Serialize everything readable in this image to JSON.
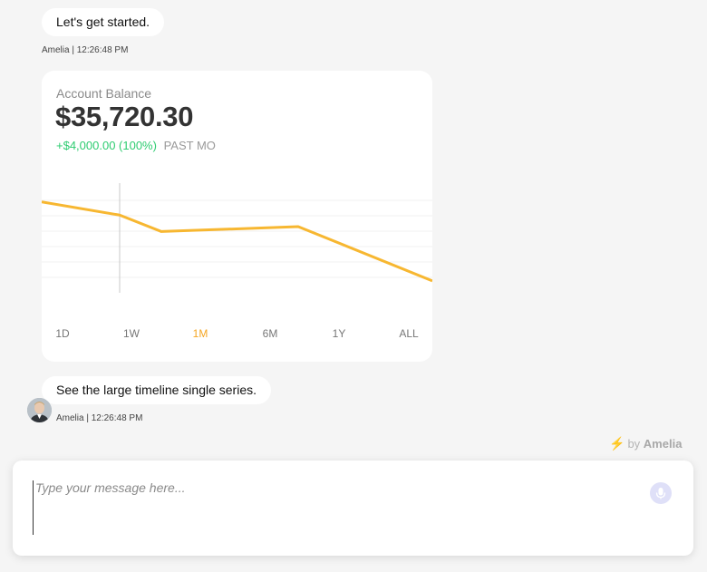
{
  "messages": [
    {
      "text": "Let's get started.",
      "meta": "Amelia | 12:26:48 PM"
    },
    {
      "text": "See the large timeline single series.",
      "meta": "Amelia | 12:26:48 PM"
    }
  ],
  "balance_card": {
    "label": "Account Balance",
    "amount": "$35,720.30",
    "change": "+$4,000.00 (100%)",
    "period": "PAST MO",
    "ranges": [
      "1D",
      "1W",
      "1M",
      "6M",
      "1Y",
      "ALL"
    ],
    "active_range": "1M",
    "active_color": "#f5a623",
    "line_color": "#f7b731"
  },
  "chart_data": {
    "type": "line",
    "series": [
      {
        "values": [
          5.8,
          5.0,
          4.0,
          4.3,
          1.0
        ]
      }
    ],
    "ylim": [
      0,
      7
    ],
    "grid": true,
    "legend": "none"
  },
  "branding": {
    "prefix": "by",
    "name": "Amelia",
    "icon": "lightning-bolt-icon"
  },
  "composer": {
    "placeholder": "Type your message here...",
    "value": "",
    "mic_icon": "microphone-icon"
  }
}
